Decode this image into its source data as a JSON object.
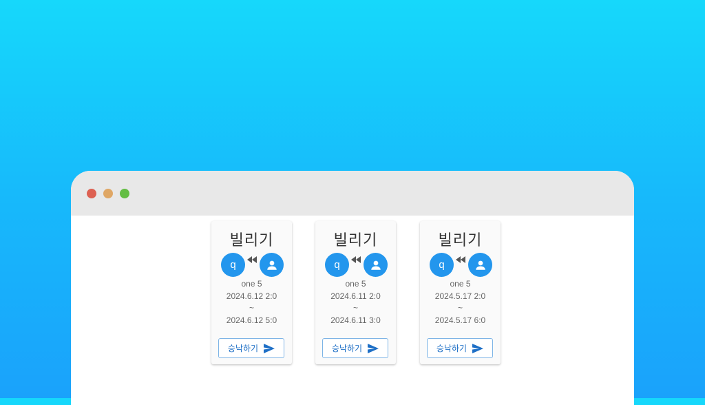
{
  "cards": [
    {
      "title": "빌리기",
      "left_avatar_letter": "q",
      "item": "one 5",
      "start": "2024.6.12 2:0",
      "separator": "~",
      "end": "2024.6.12 5:0",
      "button_label": "승낙하기"
    },
    {
      "title": "빌리기",
      "left_avatar_letter": "q",
      "item": "one 5",
      "start": "2024.6.11 2:0",
      "separator": "~",
      "end": "2024.6.11 3:0",
      "button_label": "승낙하기"
    },
    {
      "title": "빌리기",
      "left_avatar_letter": "q",
      "item": "one 5",
      "start": "2024.5.17 2:0",
      "separator": "~",
      "end": "2024.5.17 6:0",
      "button_label": "승낙하기"
    }
  ],
  "icons": {
    "window_controls": [
      "close-dot",
      "minimize-dot",
      "maximize-dot"
    ],
    "transfer": "rewind-icon",
    "user": "person-icon",
    "send": "send-icon"
  },
  "colors": {
    "accent": "#2396ed",
    "button_text": "#1e6fc6",
    "window_close": "#dd6152",
    "window_minimize": "#dfa765",
    "window_maximize": "#63bd43"
  }
}
